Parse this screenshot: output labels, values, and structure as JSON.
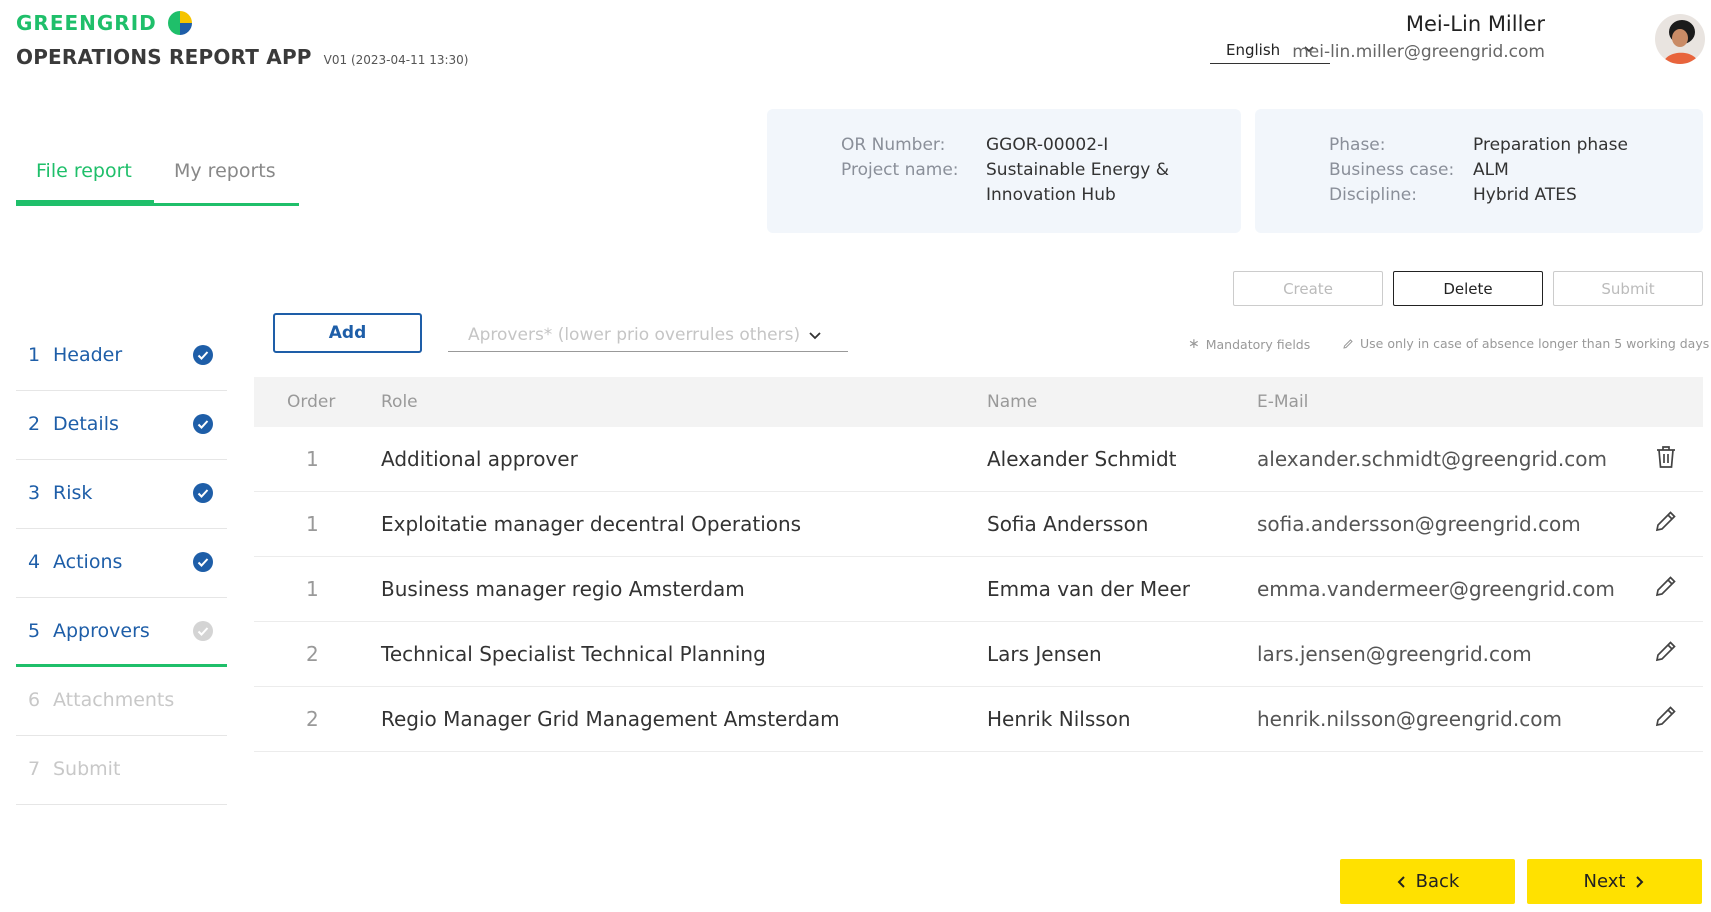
{
  "brand": {
    "name": "GREENGRID"
  },
  "app": {
    "title": "OPERATIONS REPORT APP",
    "version": "V01 (2023-04-11 13:30)"
  },
  "language": {
    "selected": "English"
  },
  "user": {
    "name": "Mei-Lin Miller",
    "email": "mei-lin.miller@greengrid.com"
  },
  "tabs": [
    {
      "label": "File report",
      "active": true
    },
    {
      "label": "My reports",
      "active": false
    }
  ],
  "report_info": {
    "or_number_label": "OR Number:",
    "or_number": "GGOR-00002-I",
    "project_name_label": "Project name:",
    "project_name_line1": "Sustainable Energy &",
    "project_name_line2": "Innovation Hub",
    "phase_label": "Phase:",
    "phase": "Preparation phase",
    "business_case_label": "Business case:",
    "business_case": "ALM",
    "discipline_label": "Discipline:",
    "discipline": "Hybrid ATES"
  },
  "actions": {
    "create": "Create",
    "delete": "Delete",
    "submit": "Submit"
  },
  "hints": {
    "mandatory": "Mandatory fields",
    "absence": "Use only in case of absence longer than 5 working days"
  },
  "add_button": "Add",
  "approver_select": {
    "placeholder": "Aprovers* (lower prio overrules others)"
  },
  "steps": [
    {
      "num": "1",
      "label": "Header",
      "state": "done"
    },
    {
      "num": "2",
      "label": "Details",
      "state": "done"
    },
    {
      "num": "3",
      "label": "Risk",
      "state": "done"
    },
    {
      "num": "4",
      "label": "Actions",
      "state": "done"
    },
    {
      "num": "5",
      "label": "Approvers",
      "state": "current"
    },
    {
      "num": "6",
      "label": "Attachments",
      "state": "disabled"
    },
    {
      "num": "7",
      "label": "Submit",
      "state": "disabled"
    }
  ],
  "table": {
    "headers": {
      "order": "Order",
      "role": "Role",
      "name": "Name",
      "email": "E-Mail"
    },
    "rows": [
      {
        "order": "1",
        "role": "Additional approver",
        "name": "Alexander Schmidt",
        "email": "alexander.schmidt@greengrid.com",
        "action": "trash-icon"
      },
      {
        "order": "1",
        "role": "Exploitatie manager decentral Operations",
        "name": "Sofia Andersson",
        "email": "sofia.andersson@greengrid.com",
        "action": "pencil-icon"
      },
      {
        "order": "1",
        "role": "Business manager regio Amsterdam",
        "name": "Emma van der Meer",
        "email": "emma.vandermeer@greengrid.com",
        "action": "pencil-icon"
      },
      {
        "order": "2",
        "role": "Technical Specialist Technical Planning",
        "name": "Lars Jensen",
        "email": "lars.jensen@greengrid.com",
        "action": "pencil-icon"
      },
      {
        "order": "2",
        "role": "Regio Manager Grid Management Amsterdam",
        "name": "Henrik Nilsson",
        "email": "henrik.nilsson@greengrid.com",
        "action": "pencil-icon"
      }
    ]
  },
  "footer": {
    "back": "Back",
    "next": "Next"
  },
  "colors": {
    "brand_green": "#1fbf6a",
    "primary_blue": "#1e5ea8",
    "accent_yellow": "#ffe100"
  }
}
